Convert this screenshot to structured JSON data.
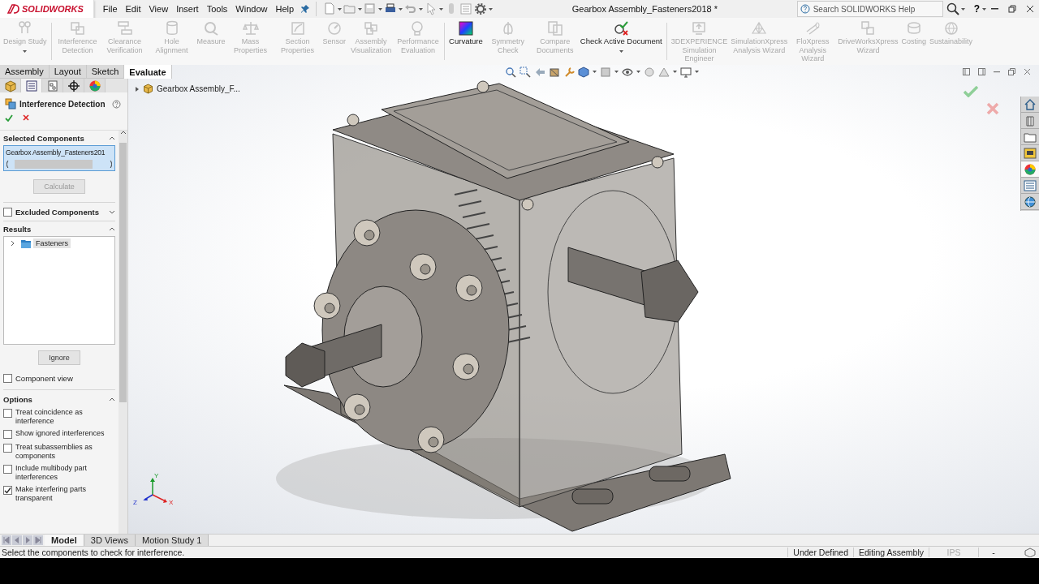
{
  "title_bar": {
    "logo": "SOLIDWORKS",
    "menus": [
      "File",
      "Edit",
      "View",
      "Insert",
      "Tools",
      "Window",
      "Help"
    ],
    "document_title": "Gearbox Assembly_Fasteners2018 *",
    "search": {
      "placeholder": "Search SOLIDWORKS Help"
    },
    "help": "?"
  },
  "ribbon": {
    "buttons": [
      {
        "label": "Design Study",
        "disabled": true,
        "dropdown": true
      },
      {
        "label": "Interference Detection",
        "disabled": true,
        "dropdown": false
      },
      {
        "label": "Clearance Verification",
        "disabled": true,
        "dropdown": false
      },
      {
        "label": "Hole Alignment",
        "disabled": true,
        "dropdown": false
      },
      {
        "label": "Measure",
        "disabled": true,
        "dropdown": false
      },
      {
        "label": "Mass Properties",
        "disabled": true,
        "dropdown": false
      },
      {
        "label": "Section Properties",
        "disabled": true,
        "dropdown": false
      },
      {
        "label": "Sensor",
        "disabled": true,
        "dropdown": false
      },
      {
        "label": "Assembly Visualization",
        "disabled": true,
        "dropdown": false
      },
      {
        "label": "Performance Evaluation",
        "disabled": true,
        "dropdown": false
      },
      {
        "label": "Curvature",
        "disabled": false,
        "dropdown": false
      },
      {
        "label": "Symmetry Check",
        "disabled": true,
        "dropdown": false
      },
      {
        "label": "Compare Documents",
        "disabled": true,
        "dropdown": false
      },
      {
        "label": "Check Active Document",
        "disabled": false,
        "dropdown": true
      },
      {
        "label": "3DEXPERIENCE Simulation Engineer",
        "disabled": true,
        "dropdown": false
      },
      {
        "label": "SimulationXpress Analysis Wizard",
        "disabled": true,
        "dropdown": false
      },
      {
        "label": "FloXpress Analysis Wizard",
        "disabled": true,
        "dropdown": false
      },
      {
        "label": "DriveWorksXpress Wizard",
        "disabled": true,
        "dropdown": false
      },
      {
        "label": "Costing",
        "disabled": true,
        "dropdown": false
      },
      {
        "label": "Sustainability",
        "disabled": true,
        "dropdown": false
      }
    ]
  },
  "ribbon_tabs": [
    {
      "label": "Assembly",
      "selected": false
    },
    {
      "label": "Layout",
      "selected": false
    },
    {
      "label": "Sketch",
      "selected": false
    },
    {
      "label": "Evaluate",
      "selected": true
    }
  ],
  "panel_tabs": [
    {
      "selected": false
    },
    {
      "selected": true
    },
    {
      "selected": false
    },
    {
      "selected": false
    },
    {
      "selected": false
    }
  ],
  "property_manager": {
    "title": "Interference Detection",
    "selected_components": {
      "header": "Selected Components",
      "items": [
        "Gearbox Assembly_Fasteners201"
      ],
      "button": {
        "label": "Calculate",
        "disabled": true
      }
    },
    "excluded_components": {
      "label": "Excluded Components",
      "checked": false
    },
    "results": {
      "header": "Results",
      "items": [
        {
          "label": "Fasteners",
          "expanded": false
        }
      ],
      "button": {
        "label": "Ignore",
        "disabled": false
      }
    },
    "component_view": {
      "label": "Component view",
      "checked": false
    },
    "options": {
      "header": "Options",
      "items": [
        {
          "label": "Treat coincidence as interference",
          "checked": false
        },
        {
          "label": "Show ignored interferences",
          "checked": false
        },
        {
          "label": "Treat subassemblies as components",
          "checked": false
        },
        {
          "label": "Include multibody part interferences",
          "checked": false
        },
        {
          "label": "Make interfering parts transparent",
          "checked": true
        }
      ]
    }
  },
  "feature_tree": {
    "root": "Gearbox Assembly_F...",
    "expanded": false
  },
  "triad": {
    "labels": [
      "Y",
      "Z",
      "X"
    ]
  },
  "task_pane": [
    {
      "selected": false
    },
    {
      "selected": false
    },
    {
      "selected": false
    },
    {
      "selected": false
    },
    {
      "selected": true
    },
    {
      "selected": false
    },
    {
      "selected": false
    }
  ],
  "bottom_tabs": [
    {
      "label": "Model",
      "selected": true
    },
    {
      "label": "3D Views",
      "selected": false
    },
    {
      "label": "Motion Study 1",
      "selected": false
    }
  ],
  "status_bar": {
    "message": "Select the components to check for interference.",
    "fields": [
      {
        "text": "Under Defined",
        "disabled": false
      },
      {
        "text": "Editing Assembly",
        "disabled": false
      },
      {
        "text": "IPS",
        "disabled": true
      },
      {
        "text": "-",
        "disabled": false
      }
    ]
  }
}
